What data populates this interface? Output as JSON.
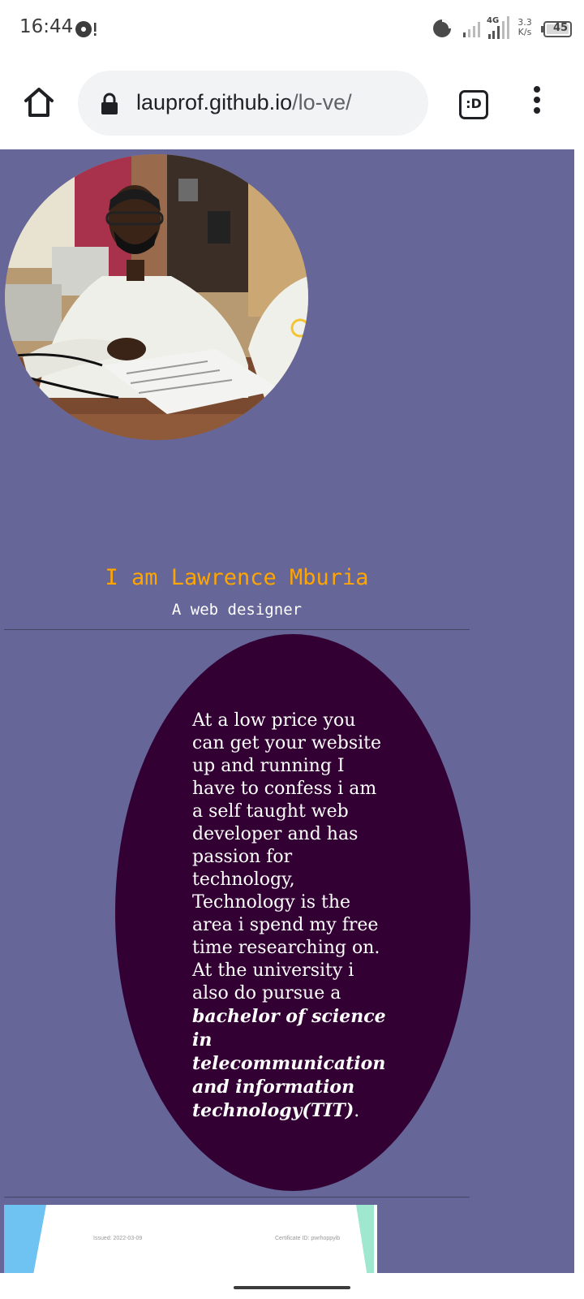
{
  "status_bar": {
    "time": "16:44",
    "network": "4G",
    "speed_value": "3.3",
    "speed_unit": "K/s",
    "battery": "45"
  },
  "browser": {
    "url_domain": "lauprof.github.io",
    "url_path": "/lo-ve/",
    "tabs_label": ":D"
  },
  "profile": {
    "name": "I am Lawrence Mburia",
    "tagline": "A web designer"
  },
  "bio": {
    "text": "At a low price you can get your website up and running I have to confess i am a self taught web developer and has passion for technology, Technology is the area i spend my free time researching on. At the university i also do pursue a ",
    "degree": "bachelor of science in telecommunication and information technology(TIT)",
    "end": "."
  },
  "certificate": {
    "issued": "Issued: 2022-03-09",
    "id": "Certificate ID: pwrhoppyib"
  },
  "colors": {
    "page_bg": "#666699",
    "name_color": "#ffa500",
    "oval_bg": "#330033"
  },
  "icons": [
    "notification-icon",
    "data-saver-icon",
    "signal-icon",
    "battery-icon",
    "home-icon",
    "lock-icon",
    "tabs-icon",
    "more-vert-icon"
  ]
}
